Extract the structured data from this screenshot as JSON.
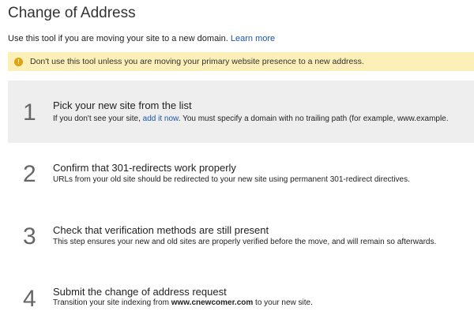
{
  "page": {
    "title": "Change of Address"
  },
  "intro": {
    "text": "Use this tool if you are moving your site to a new domain.",
    "learn_more_link": "Learn more"
  },
  "warning": {
    "icon": "alert-icon",
    "icon_glyph": "!",
    "text": "Don't use this tool unless you are moving your primary website presence to a new address."
  },
  "steps": [
    {
      "number": "1",
      "title": "Pick your new site from the list",
      "desc_prefix": "If you don't see your site,",
      "desc_link": "add it now",
      "desc_suffix": ". You must specify a domain with no trailing path (for example, www.example.",
      "active": true
    },
    {
      "number": "2",
      "title": "Confirm that 301-redirects work properly",
      "desc": "URLs from your old site should be redirected to your new site using permanent 301-redirect directives."
    },
    {
      "number": "3",
      "title": "Check that verification methods are still present",
      "desc": "This step ensures your new and old sites are properly verified before the move, and will remain so afterwards."
    },
    {
      "number": "4",
      "title": "Submit the change of address request",
      "desc_prefix": "Transition your site indexing from",
      "desc_bold": "www.cnewcomer.com",
      "desc_suffix": "to your new site."
    }
  ],
  "colors": {
    "link": "#1a56a8",
    "warning_bg": "#fcefb8",
    "warning_icon": "#e0a30e",
    "active_step_bg": "#eeeeee"
  }
}
